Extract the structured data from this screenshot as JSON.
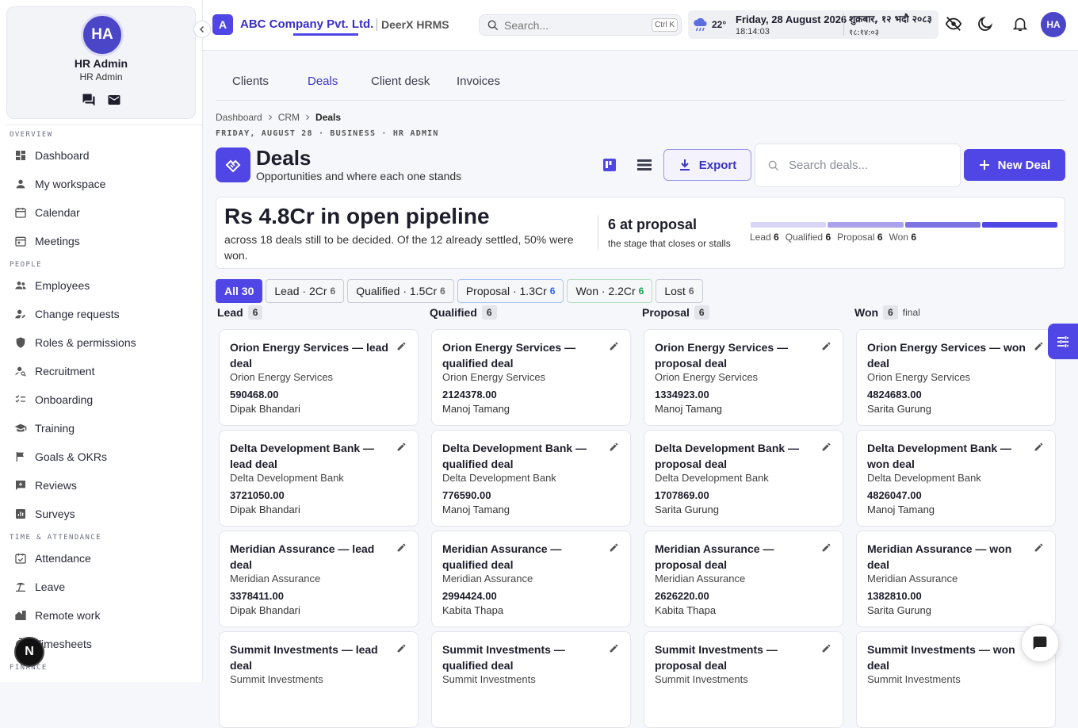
{
  "user": {
    "initials": "HA",
    "name": "HR Admin",
    "role": "HR Admin"
  },
  "sidebar": {
    "sections": {
      "overview": "OVERVIEW",
      "people": "PEOPLE",
      "time": "TIME & ATTENDANCE",
      "finance": "FINANCE"
    },
    "items": [
      {
        "label": "Dashboard",
        "icon": "dashboard-icon"
      },
      {
        "label": "My workspace",
        "icon": "person-icon"
      },
      {
        "label": "Calendar",
        "icon": "calendar-icon"
      },
      {
        "label": "Meetings",
        "icon": "meetings-icon"
      },
      {
        "label": "Employees",
        "icon": "people-icon"
      },
      {
        "label": "Change requests",
        "icon": "person-edit-icon"
      },
      {
        "label": "Roles & permissions",
        "icon": "shield-icon"
      },
      {
        "label": "Recruitment",
        "icon": "person-search-icon"
      },
      {
        "label": "Onboarding",
        "icon": "checklist-icon"
      },
      {
        "label": "Training",
        "icon": "graduation-cap-icon"
      },
      {
        "label": "Goals & OKRs",
        "icon": "flag-icon"
      },
      {
        "label": "Reviews",
        "icon": "rate-review-icon"
      },
      {
        "label": "Surveys",
        "icon": "poll-icon"
      },
      {
        "label": "Attendance",
        "icon": "calendar-check-icon"
      },
      {
        "label": "Leave",
        "icon": "beach-icon"
      },
      {
        "label": "Remote work",
        "icon": "home-work-icon"
      },
      {
        "label": "Timesheets",
        "icon": "timer-icon"
      }
    ],
    "next_badge": "N"
  },
  "header": {
    "logo_letter": "A",
    "company": "ABC Company Pvt. Ltd.",
    "app": "DeerX HRMS",
    "search_placeholder": "Search...",
    "search_shortcut": "Ctrl K",
    "temperature": "22°",
    "date_en": "Friday, 28 August 2026",
    "time_en": "18:14:03",
    "date_np": "शुक्रबार, १२ भदौ २०८३",
    "time_np": "१८:१४:०३"
  },
  "tabs": [
    "Clients",
    "Deals",
    "Client desk",
    "Invoices"
  ],
  "breadcrumb": [
    "Dashboard",
    "CRM",
    "Deals"
  ],
  "meta_line": "FRIDAY, AUGUST 28 · BUSINESS · HR ADMIN",
  "page": {
    "title": "Deals",
    "subtitle": "Opportunities and where each one stands",
    "export_label": "Export",
    "search_placeholder": "Search deals...",
    "new_label": "New Deal"
  },
  "summary": {
    "pipeline": "Rs 4.8Cr in open pipeline",
    "pipeline_text": "across 18 deals still to be decided. Of the 12 already settled, 50% were won.",
    "stage_big": "6 at proposal",
    "stage_sub": "the stage that closes or stalls",
    "bar_colors": [
      "#d6d4f7",
      "#a8a3ec",
      "#7c74e2",
      "#4f46e5"
    ],
    "legend": [
      {
        "label": "Lead",
        "count": "6"
      },
      {
        "label": "Qualified",
        "count": "6"
      },
      {
        "label": "Proposal",
        "count": "6"
      },
      {
        "label": "Won",
        "count": "6"
      }
    ]
  },
  "filters": [
    {
      "label": "All 30",
      "count": ""
    },
    {
      "label": "Lead · 2Cr",
      "count": "6"
    },
    {
      "label": "Qualified · 1.5Cr",
      "count": "6"
    },
    {
      "label": "Proposal · 1.3Cr",
      "count": "6"
    },
    {
      "label": "Won · 2.2Cr",
      "count": "6"
    },
    {
      "label": "Lost",
      "count": "6"
    }
  ],
  "columns": [
    {
      "name": "Lead",
      "count": "6",
      "note": "",
      "cards": [
        {
          "title": "Orion Energy Services — lead deal",
          "client": "Orion Energy Services",
          "amount": "590468.00",
          "owner": "Dipak Bhandari"
        },
        {
          "title": "Delta Development Bank — lead deal",
          "client": "Delta Development Bank",
          "amount": "3721050.00",
          "owner": "Dipak Bhandari"
        },
        {
          "title": "Meridian Assurance — lead deal",
          "client": "Meridian Assurance",
          "amount": "3378411.00",
          "owner": "Dipak Bhandari"
        },
        {
          "title": "Summit Investments — lead deal",
          "client": "Summit Investments",
          "amount": "",
          "owner": ""
        }
      ]
    },
    {
      "name": "Qualified",
      "count": "6",
      "note": "",
      "cards": [
        {
          "title": "Orion Energy Services — qualified deal",
          "client": "Orion Energy Services",
          "amount": "2124378.00",
          "owner": "Manoj Tamang"
        },
        {
          "title": "Delta Development Bank — qualified deal",
          "client": "Delta Development Bank",
          "amount": "776590.00",
          "owner": "Manoj Tamang"
        },
        {
          "title": "Meridian Assurance — qualified deal",
          "client": "Meridian Assurance",
          "amount": "2994424.00",
          "owner": "Kabita Thapa"
        },
        {
          "title": "Summit Investments — qualified deal",
          "client": "Summit Investments",
          "amount": "",
          "owner": ""
        }
      ]
    },
    {
      "name": "Proposal",
      "count": "6",
      "note": "",
      "cards": [
        {
          "title": "Orion Energy Services — proposal deal",
          "client": "Orion Energy Services",
          "amount": "1334923.00",
          "owner": "Manoj Tamang"
        },
        {
          "title": "Delta Development Bank — proposal deal",
          "client": "Delta Development Bank",
          "amount": "1707869.00",
          "owner": "Sarita Gurung"
        },
        {
          "title": "Meridian Assurance — proposal deal",
          "client": "Meridian Assurance",
          "amount": "2626220.00",
          "owner": "Kabita Thapa"
        },
        {
          "title": "Summit Investments — proposal deal",
          "client": "Summit Investments",
          "amount": "",
          "owner": ""
        }
      ]
    },
    {
      "name": "Won",
      "count": "6",
      "note": "final",
      "cards": [
        {
          "title": "Orion Energy Services — won deal",
          "client": "Orion Energy Services",
          "amount": "4824683.00",
          "owner": "Sarita Gurung"
        },
        {
          "title": "Delta Development Bank — won deal",
          "client": "Delta Development Bank",
          "amount": "4826047.00",
          "owner": "Manoj Tamang"
        },
        {
          "title": "Meridian Assurance — won deal",
          "client": "Meridian Assurance",
          "amount": "1382810.00",
          "owner": "Sarita Gurung"
        },
        {
          "title": "Summit Investments — won deal",
          "client": "Summit Investments",
          "amount": "",
          "owner": ""
        }
      ]
    }
  ]
}
